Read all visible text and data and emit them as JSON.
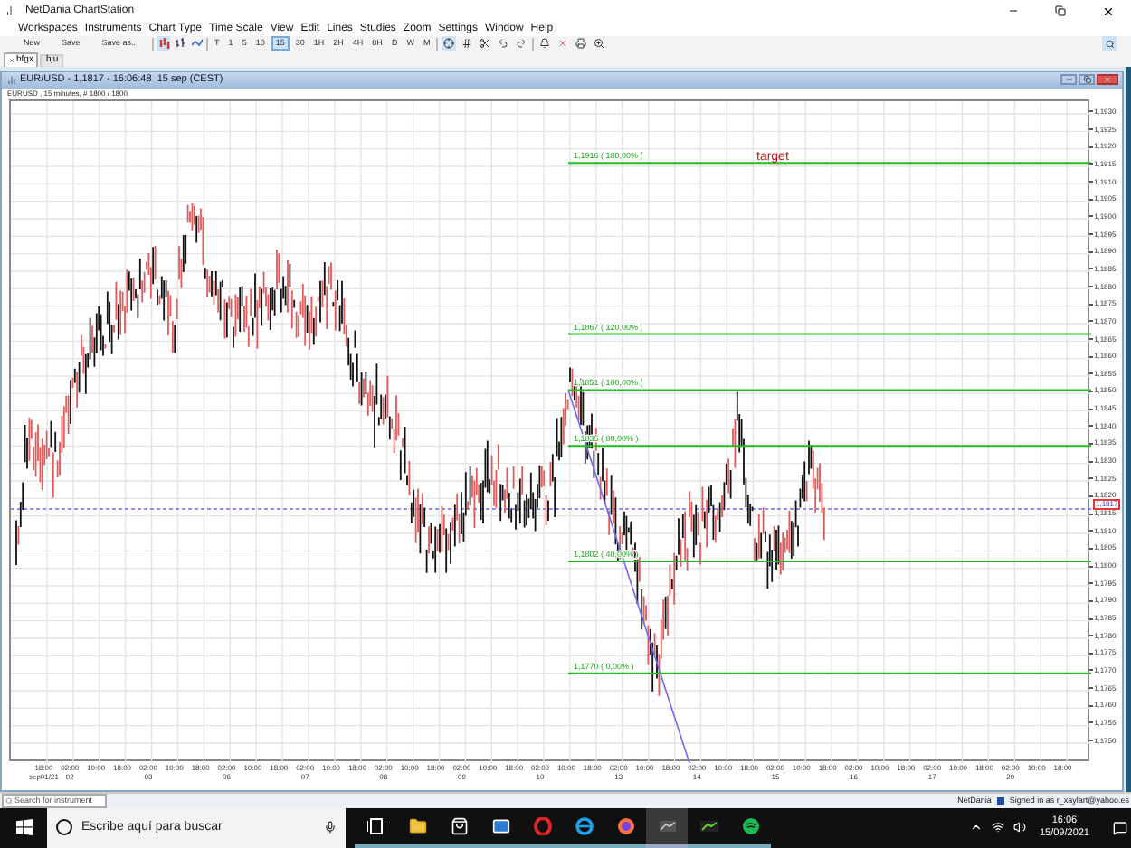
{
  "window": {
    "title": "NetDania ChartStation"
  },
  "menu": [
    "Workspaces",
    "Instruments",
    "Chart Type",
    "Time Scale",
    "View",
    "Edit",
    "Lines",
    "Studies",
    "Zoom",
    "Settings",
    "Window",
    "Help"
  ],
  "toolbar": {
    "file_buttons": [
      "New",
      "Save",
      "Save as.."
    ],
    "intervals": [
      {
        "label": "T",
        "selected": false
      },
      {
        "label": "1",
        "selected": false
      },
      {
        "label": "5",
        "selected": false
      },
      {
        "label": "10",
        "selected": false
      },
      {
        "label": "15",
        "selected": true
      },
      {
        "label": "30",
        "selected": false
      },
      {
        "label": "1H",
        "selected": false
      },
      {
        "label": "2H",
        "selected": false
      },
      {
        "label": "4H",
        "selected": false
      },
      {
        "label": "8H",
        "selected": false
      },
      {
        "label": "D",
        "selected": false
      },
      {
        "label": "W",
        "selected": false
      },
      {
        "label": "M",
        "selected": false
      }
    ]
  },
  "tabs": [
    {
      "label": "bfgx",
      "selected": true
    },
    {
      "label": "hju",
      "selected": false
    }
  ],
  "chart_window": {
    "title": "EUR/USD - 1,1817 - 16:06:48  15 sep (CEST)",
    "subtitle": "EURUSD , 15 minutes, # 1800 / 1800",
    "price_axis": [
      "1,1930",
      "1,1925",
      "1,1920",
      "1,1915",
      "1,1910",
      "1,1905",
      "1,1900",
      "1,1895",
      "1,1890",
      "1,1885",
      "1,1880",
      "1,1875",
      "1,1870",
      "1,1865",
      "1,1860",
      "1,1855",
      "1,1850",
      "1,1845",
      "1,1840",
      "1,1835",
      "1,1830",
      "1,1825",
      "1,1820",
      "1,1815",
      "1,1810",
      "1,1805",
      "1,1800",
      "1,1795",
      "1,1790",
      "1,1785",
      "1,1780",
      "1,1775",
      "1,1770",
      "1,1765",
      "1,1760",
      "1,1755",
      "1,1750"
    ],
    "current_price": "1,1817",
    "annotation": "target",
    "fib_levels": [
      {
        "label": "1,1916 ( 180,00% )"
      },
      {
        "label": "1,1867 ( 120,00% )"
      },
      {
        "label": "1,1851 ( 100,00% )"
      },
      {
        "label": "1,1835 ( 80,00% )"
      },
      {
        "label": "1,1802 ( 40,00% )"
      },
      {
        "label": "1,1770 ( 0,00% )"
      }
    ],
    "time_axis": [
      {
        "time": "18:00",
        "date": "sep01/21"
      },
      {
        "time": "02:00",
        "date": "02"
      },
      {
        "time": "10:00"
      },
      {
        "time": "18:00"
      },
      {
        "time": "02:00",
        "date": "03"
      },
      {
        "time": "10:00"
      },
      {
        "time": "18:00"
      },
      {
        "time": "02:00",
        "date": "06"
      },
      {
        "time": "10:00"
      },
      {
        "time": "18:00"
      },
      {
        "time": "02:00",
        "date": "07"
      },
      {
        "time": "10:00"
      },
      {
        "time": "18:00"
      },
      {
        "time": "02:00",
        "date": "08"
      },
      {
        "time": "10:00"
      },
      {
        "time": "18:00"
      },
      {
        "time": "02:00",
        "date": "09"
      },
      {
        "time": "10:00"
      },
      {
        "time": "18:00"
      },
      {
        "time": "02:00",
        "date": "10"
      },
      {
        "time": "10:00"
      },
      {
        "time": "18:00"
      },
      {
        "time": "02:00",
        "date": "13"
      },
      {
        "time": "10:00"
      },
      {
        "time": "18:00"
      },
      {
        "time": "02:00",
        "date": "14"
      },
      {
        "time": "10:00"
      },
      {
        "time": "18:00"
      },
      {
        "time": "02:00",
        "date": "15"
      },
      {
        "time": "10:00"
      },
      {
        "time": "18:00"
      },
      {
        "time": "02:00",
        "date": "16"
      },
      {
        "time": "10:00"
      },
      {
        "time": "18:00"
      },
      {
        "time": "02:00",
        "date": "17"
      },
      {
        "time": "10:00"
      },
      {
        "time": "18:00"
      },
      {
        "time": "02:00",
        "date": "20"
      },
      {
        "time": "10:00"
      },
      {
        "time": "18:00"
      }
    ]
  },
  "status_bar": {
    "search": {
      "placeholder": "Search for instrument"
    },
    "provider": "NetDania",
    "signed_in": "Signed in as r_xaylart@yahoo.es"
  },
  "taskbar": {
    "search": {
      "placeholder": "Escribe aquí para buscar"
    },
    "time": "16:06",
    "date": "15/09/2021"
  }
}
